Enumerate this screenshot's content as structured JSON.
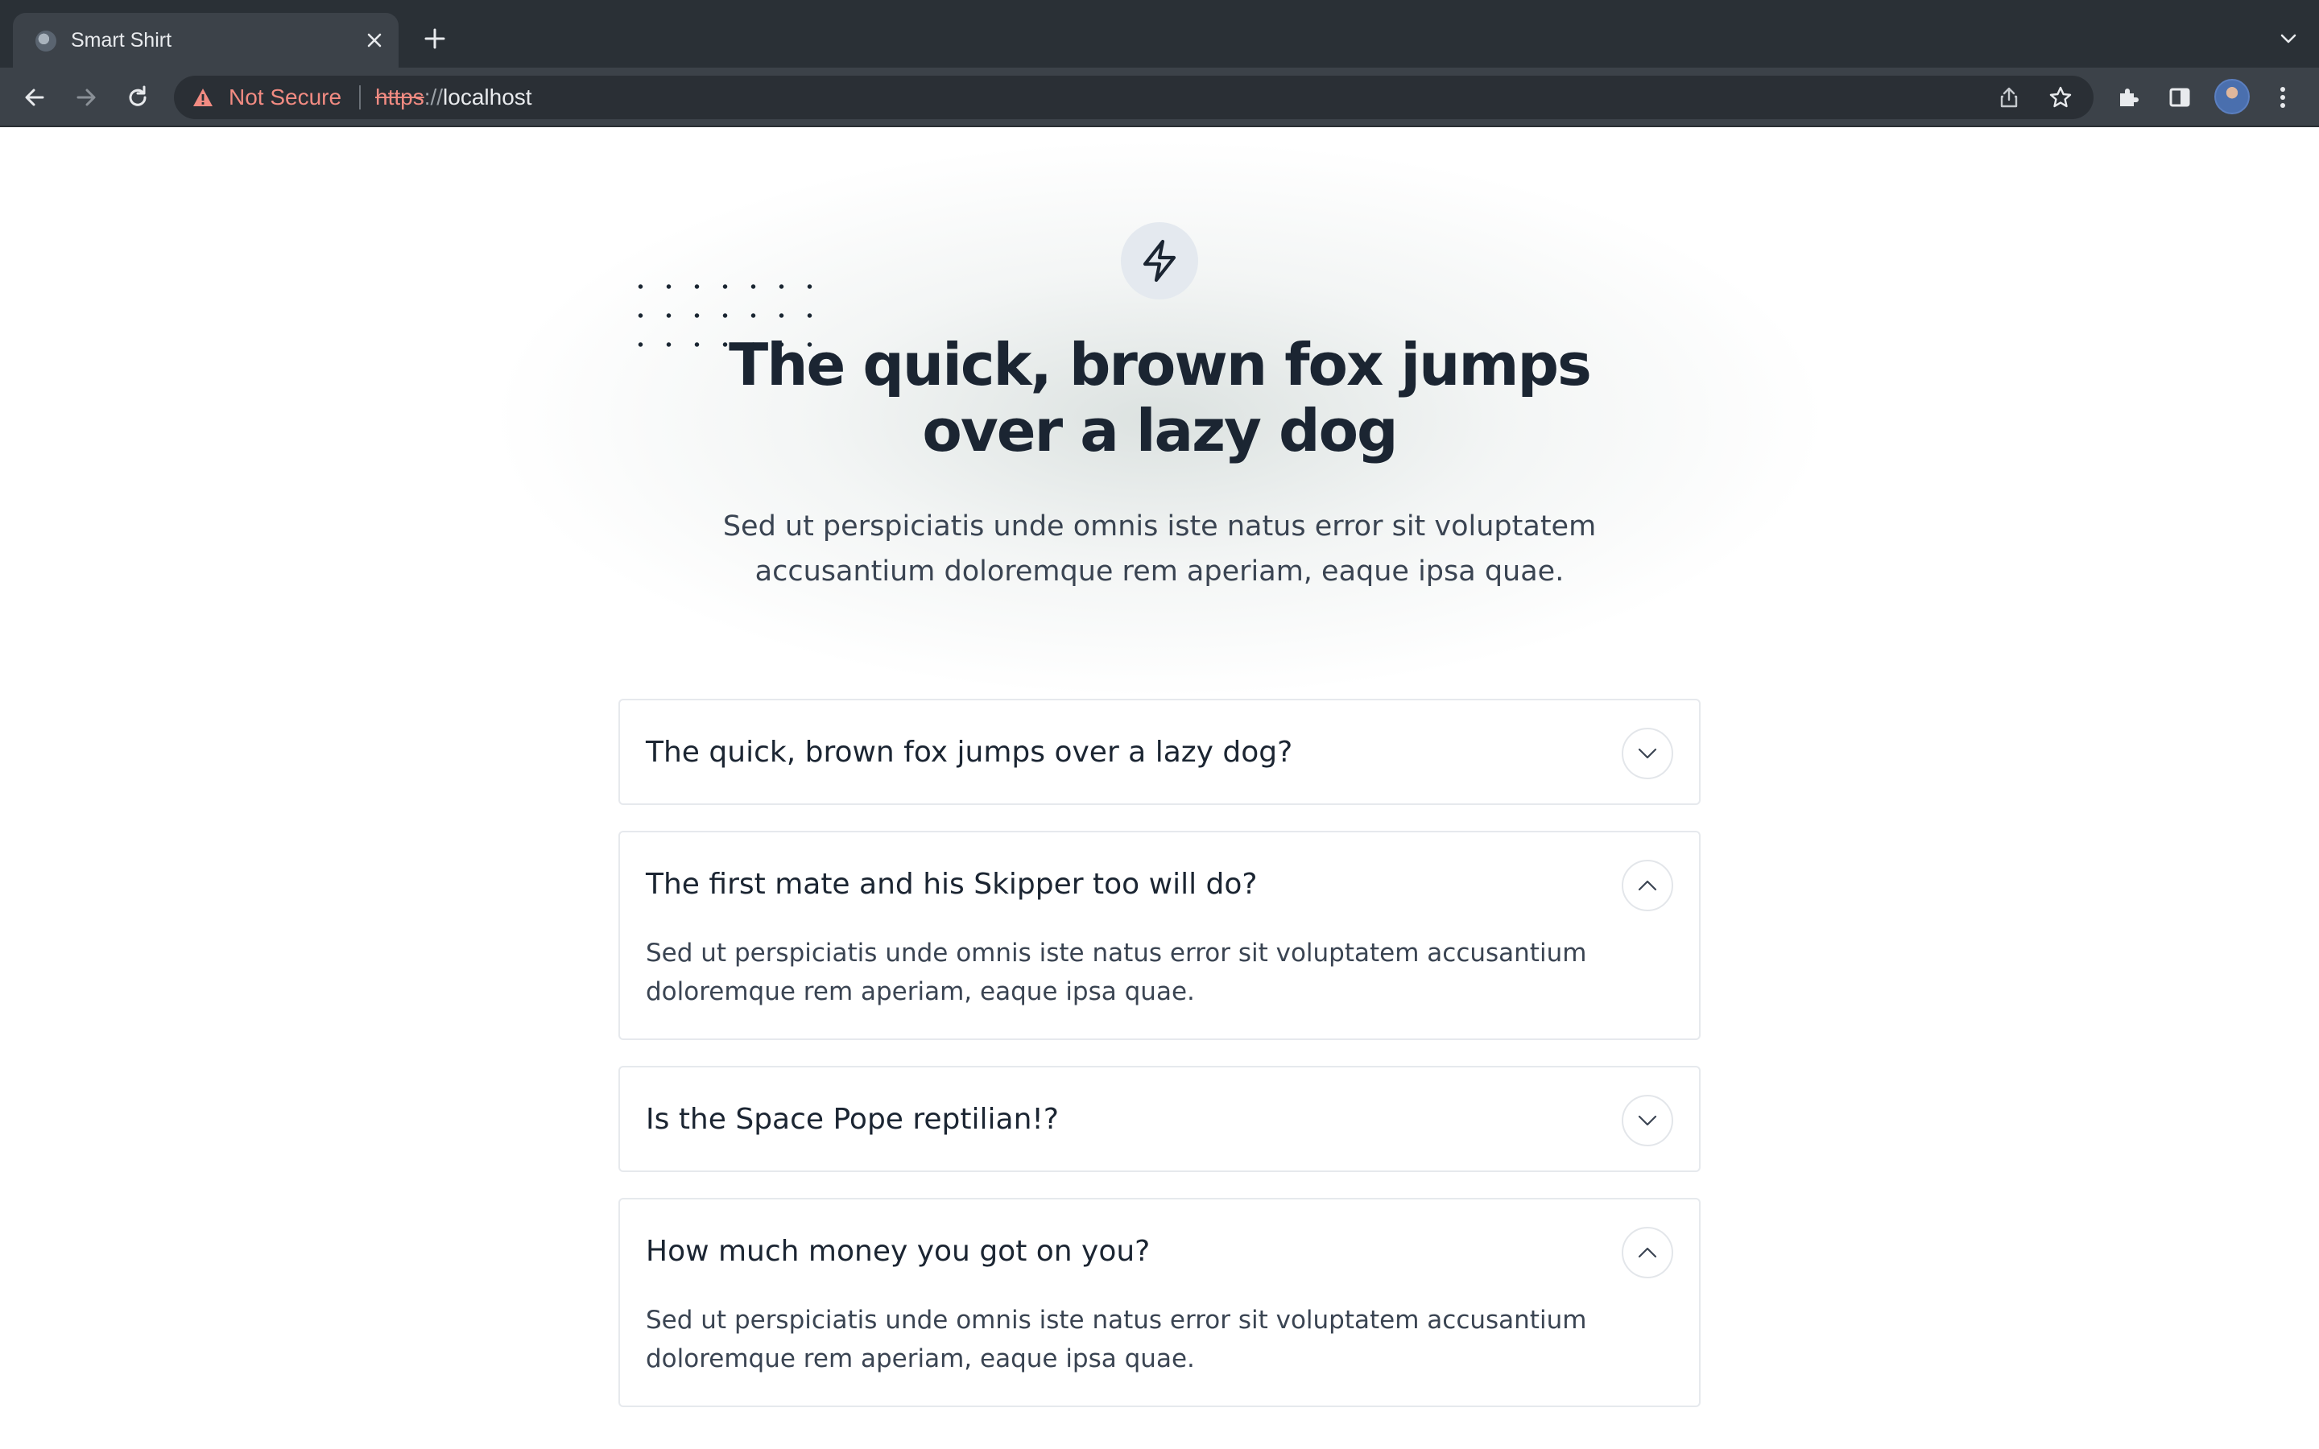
{
  "browser": {
    "tab_title": "Smart Shirt",
    "security_label": "Not Secure",
    "url_scheme": "https",
    "url_separator": "://",
    "url_host": "localhost"
  },
  "hero": {
    "icon": "lightning-icon",
    "title": "The quick, brown fox jumps over a lazy dog",
    "subtitle": "Sed ut perspiciatis unde omnis iste natus error sit voluptatem accusantium doloremque rem aperiam, eaque ipsa quae."
  },
  "faq": [
    {
      "question": "The quick, brown fox jumps over a lazy dog?",
      "expanded": false,
      "answer": ""
    },
    {
      "question": "The first mate and his Skipper too will do?",
      "expanded": true,
      "answer": "Sed ut perspiciatis unde omnis iste natus error sit voluptatem accusantium doloremque rem aperiam, eaque ipsa quae."
    },
    {
      "question": "Is the Space Pope reptilian!?",
      "expanded": false,
      "answer": ""
    },
    {
      "question": "How much money you got on you?",
      "expanded": true,
      "answer": "Sed ut perspiciatis unde omnis iste natus error sit voluptatem accusantium doloremque rem aperiam, eaque ipsa quae."
    }
  ]
}
